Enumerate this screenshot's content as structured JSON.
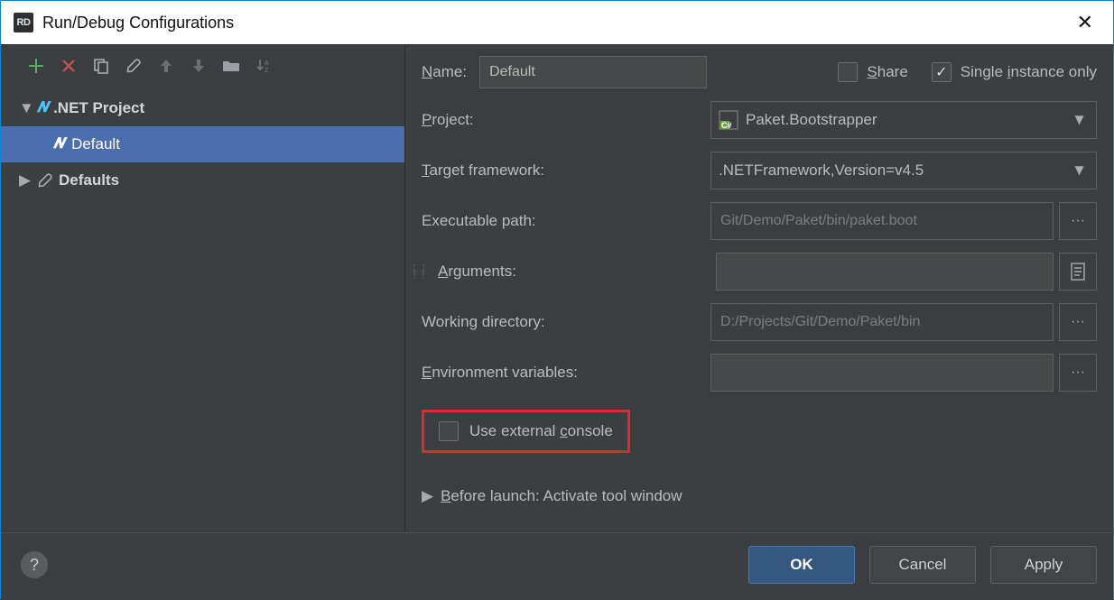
{
  "titlebar": {
    "app_badge": "RD",
    "title": "Run/Debug Configurations"
  },
  "tree": {
    "group_label": ".NET Project",
    "item_label": "Default",
    "defaults_label": "Defaults"
  },
  "form": {
    "name_label": "Name:",
    "name_value": "Default",
    "share_label": "Share",
    "single_instance_label": "Single instance only",
    "project_label": "Project:",
    "project_value": "Paket.Bootstrapper",
    "target_label": "Target framework:",
    "target_value": ".NETFramework,Version=v4.5",
    "exe_label": "Executable path:",
    "exe_value": "Git/Demo/Paket/bin/paket.boot",
    "args_label": "Arguments:",
    "args_value": "",
    "wd_label": "Working directory:",
    "wd_value": "D:/Projects/Git/Demo/Paket/bin",
    "env_label": "Environment variables:",
    "env_value": "",
    "use_external_label": "Use external console",
    "before_launch_label": "Before launch: Activate tool window"
  },
  "footer": {
    "ok": "OK",
    "cancel": "Cancel",
    "apply": "Apply"
  }
}
